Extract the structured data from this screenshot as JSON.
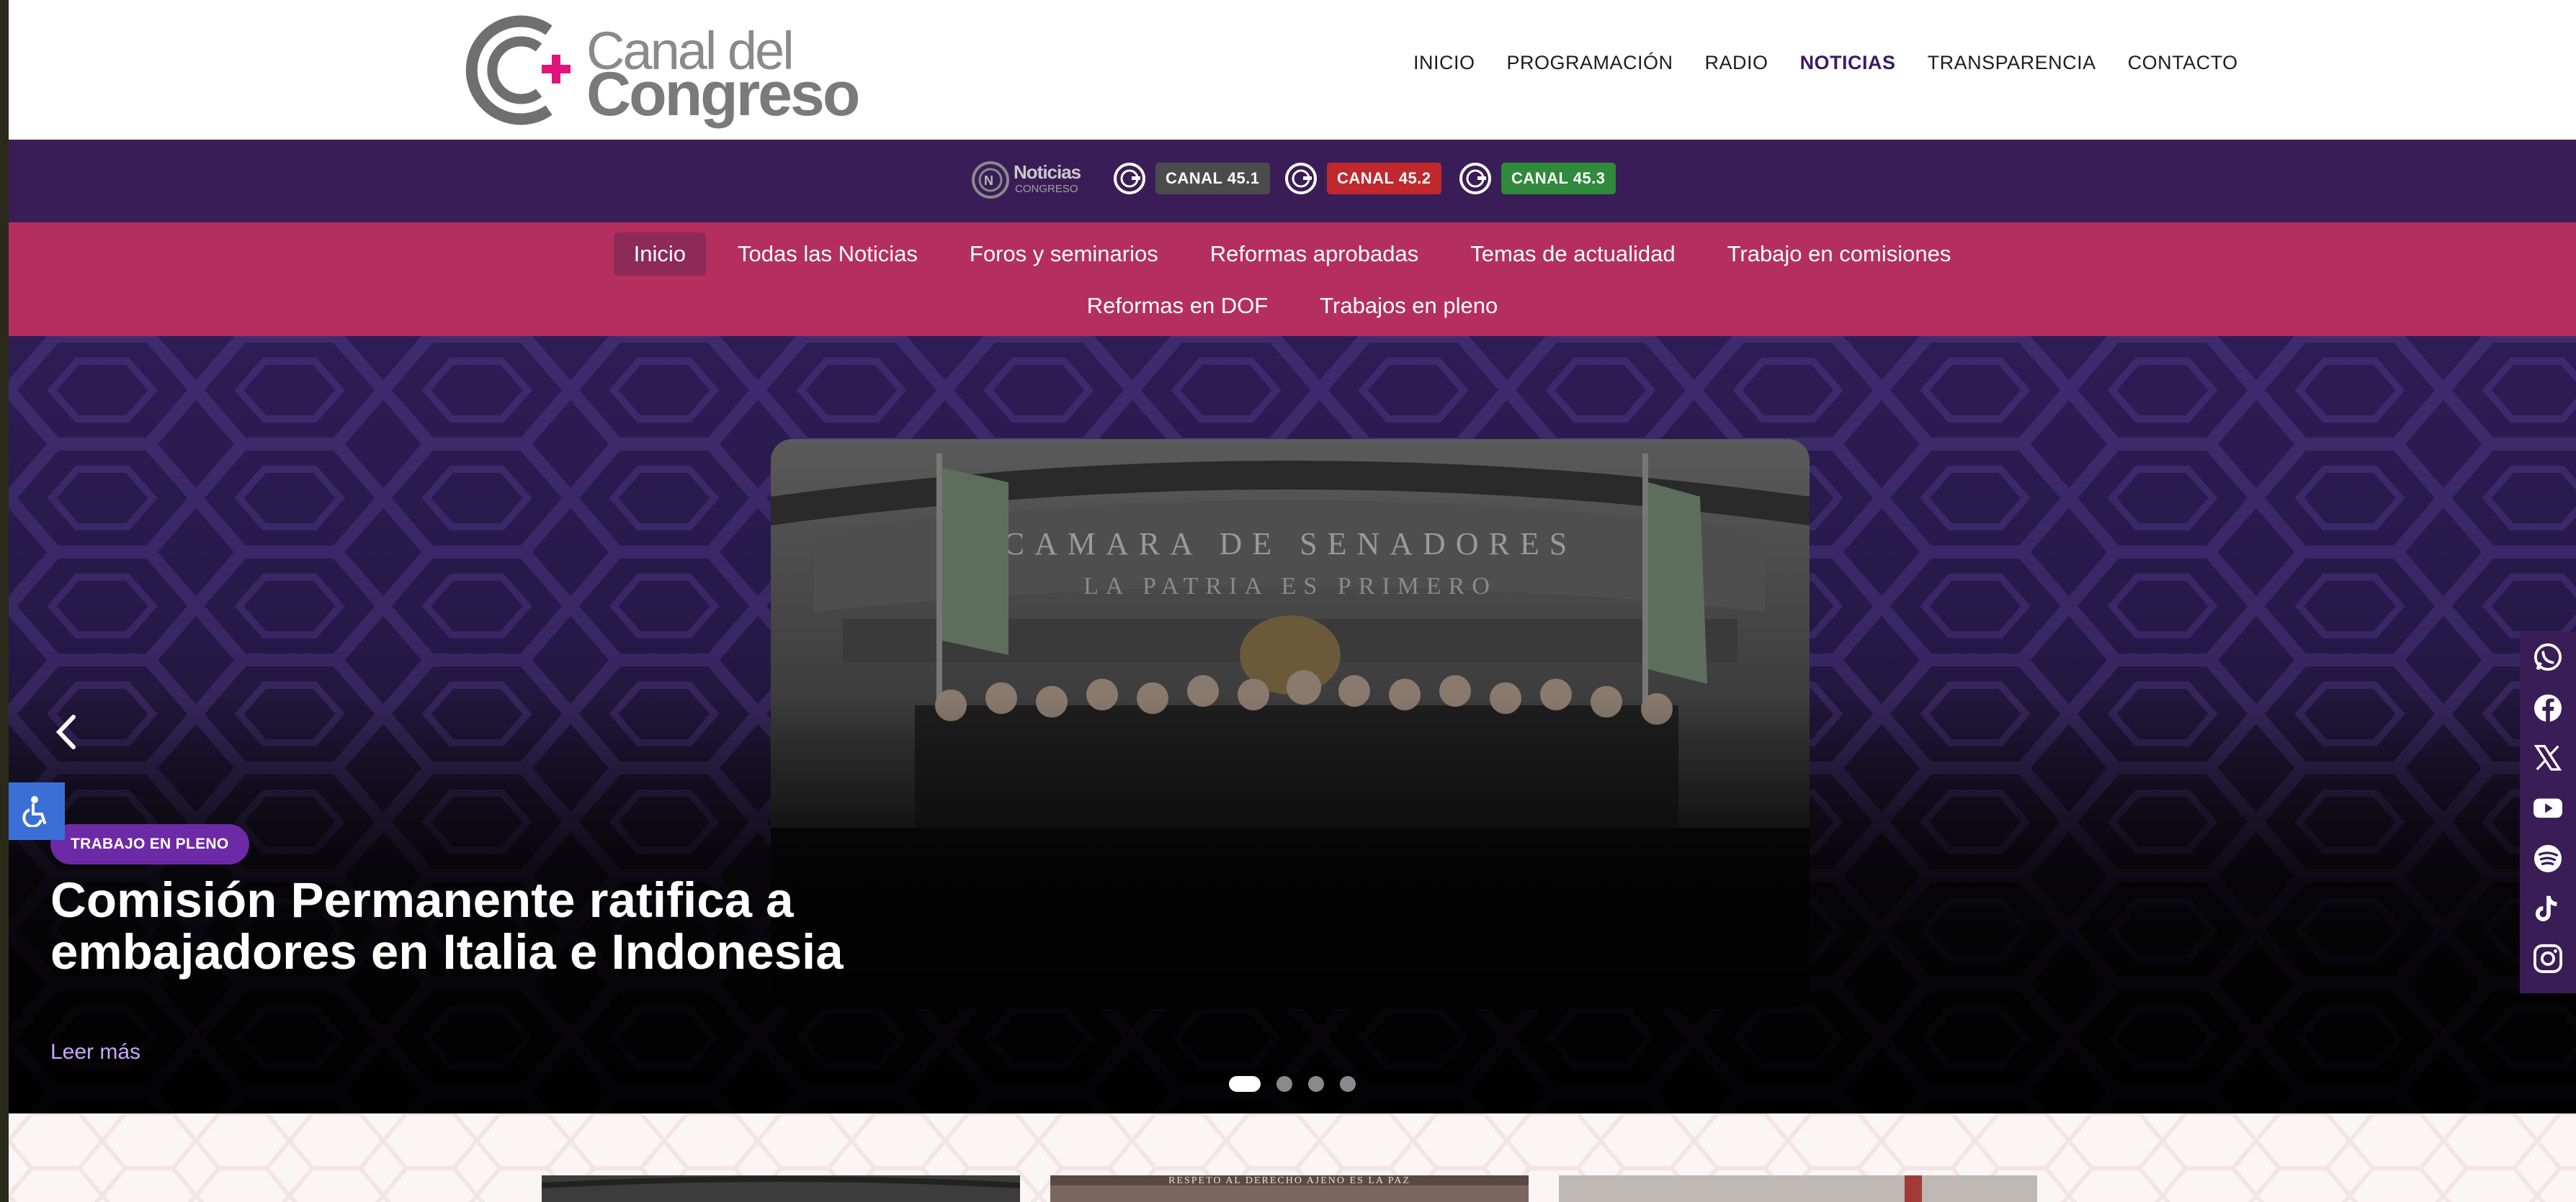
{
  "header": {
    "logo": {
      "line1": "Canal del",
      "line2": "Congreso"
    },
    "nav": [
      {
        "label": "INICIO",
        "active": false
      },
      {
        "label": "PROGRAMACIÓN",
        "active": false
      },
      {
        "label": "RADIO",
        "active": false
      },
      {
        "label": "NOTICIAS",
        "active": true
      },
      {
        "label": "TRANSPARENCIA",
        "active": false
      },
      {
        "label": "CONTACTO",
        "active": false
      }
    ]
  },
  "channelbar": {
    "noticias_logo": {
      "line1": "Noticias",
      "line2": "CONGRESO"
    },
    "channels": [
      {
        "label": "CANAL 45.1",
        "color": "#4b4b4b"
      },
      {
        "label": "CANAL 45.2",
        "color": "#c0282d"
      },
      {
        "label": "CANAL 45.3",
        "color": "#2f8a3c"
      }
    ]
  },
  "categories": {
    "row1": [
      "Inicio",
      "Todas las Noticias",
      "Foros y seminarios",
      "Reformas aprobadas",
      "Temas de actualidad",
      "Trabajo en comisiones"
    ],
    "row2": [
      "Reformas en DOF",
      "Trabajos en pleno"
    ],
    "active": "Inicio"
  },
  "hero": {
    "tag": "TRABAJO EN PLENO",
    "title": "Comisión Permanente ratifica a embajadores en Italia e Indonesia",
    "read_more": "Leer más",
    "slides_count": 4,
    "active_slide": 1,
    "image_caption_1": "CAMARA DE SENADORES",
    "image_caption_2": "LA PATRIA ES PRIMERO"
  },
  "social": [
    "whatsapp-icon",
    "facebook-icon",
    "x-icon",
    "youtube-icon",
    "spotify-icon",
    "tiktok-icon",
    "instagram-icon"
  ],
  "lower": {
    "thumb_caption_2": "RESPETO AL DERECHO AJENO ES LA PAZ"
  },
  "colors": {
    "brand_purple": "#3a1d57",
    "category_pink": "#b52f5e",
    "tag_purple": "#6d2aa6",
    "accessibility_blue": "#3b6fd6",
    "logo_magenta": "#e0147a"
  }
}
